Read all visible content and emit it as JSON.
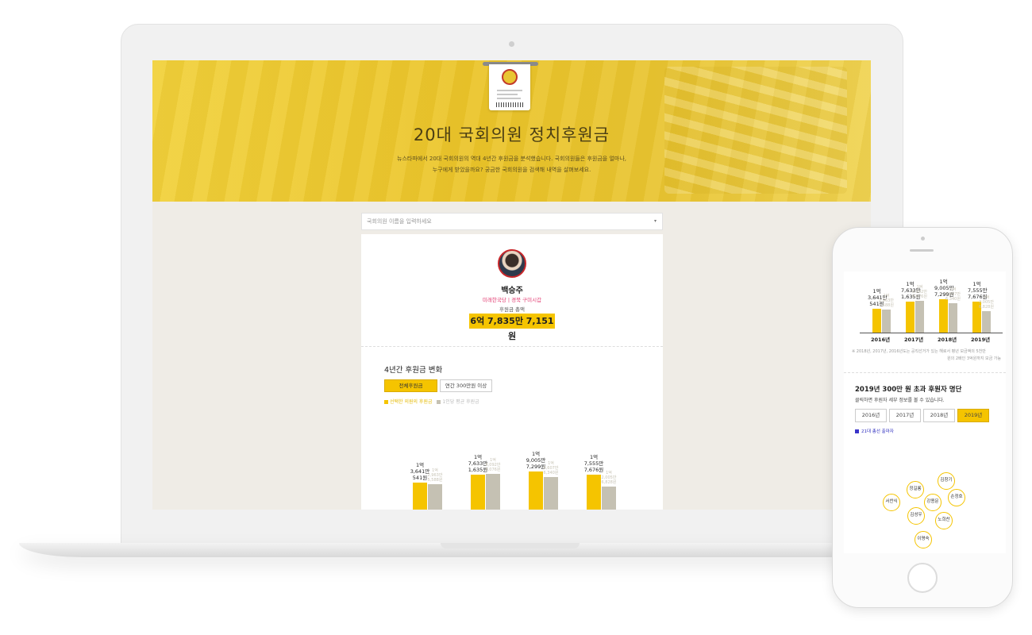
{
  "laptop": {
    "hero": {
      "title": "20대 국회의원 정치후원금",
      "desc_line1": "뉴스타파에서 20대 국회의원의 역대 4년간 후원금을 분석했습니다. 국회의원들은 후원금을 얼마나,",
      "desc_line2": "누구에게 받았을까요? 궁금한 국회의원을 검색해 내역을 살펴보세요."
    },
    "search": {
      "placeholder": "국회의원 이름을 입력하세요",
      "caret": "▾"
    },
    "profile": {
      "name": "백승주",
      "party": "미래한국당 | 경북 구미시갑",
      "total_label": "후원금 총액",
      "total_value": "6억 7,835만 7,151원"
    },
    "section_title": "4년간 후원금 변화",
    "buttons": {
      "all": "전체후원금",
      "over300": "연간 300만원 이상"
    },
    "legend": {
      "selected": "선택한 의원의 후원금",
      "average": "1인당 평균 후원금"
    }
  },
  "chart_data": {
    "type": "bar",
    "categories": [
      "2016년",
      "2017년",
      "2018년",
      "2019년"
    ],
    "series": [
      {
        "name": "선택한 의원의 후원금",
        "values": [
          136410541,
          176331635,
          190057299,
          175557676
        ],
        "labels": [
          "1억\n3,641만\n541원",
          "1억\n7,633만\n1,635원",
          "1억\n9,005만\n7,299원",
          "1억\n7,555만\n7,676원"
        ]
      },
      {
        "name": "1인당 평균 후원금",
        "values": [
          129635588,
          180928076,
          166076340,
          120056828
        ],
        "labels": [
          "1억\n2,963만\n5,588원",
          "1억\n8,092만\n8,076원",
          "1억\n6,607만\n6,340원",
          "1억\n2,005만\n6,828원"
        ]
      }
    ],
    "ylim": [
      0,
      260000000
    ],
    "colors": {
      "selected": "#f5c400",
      "average": "#c5c1b3"
    }
  },
  "phone": {
    "years": [
      "2016년",
      "2017년",
      "2018년",
      "2019년"
    ],
    "note_line1": "※ 2018년, 2017년, 2016년도는 공직선거가 있는 해로서 평년 모금액의 5천만",
    "note_line2": "원의 2배인 3억원까지 모금 가능",
    "donors_title": "2019년 300만 원 초과 후원자 명단",
    "donors_sub": "클릭하면 후원자 세부 정보를 볼 수 있습니다.",
    "tabs": [
      "2016년",
      "2017년",
      "2018년",
      "2019년"
    ],
    "active_tab": "2019년",
    "legend": "21대 총선 출마자",
    "donors": [
      "김창기",
      "정길룡",
      "손정호",
      "서찬식",
      "강용문",
      "김성우",
      "노희찬",
      "이명숙"
    ]
  }
}
